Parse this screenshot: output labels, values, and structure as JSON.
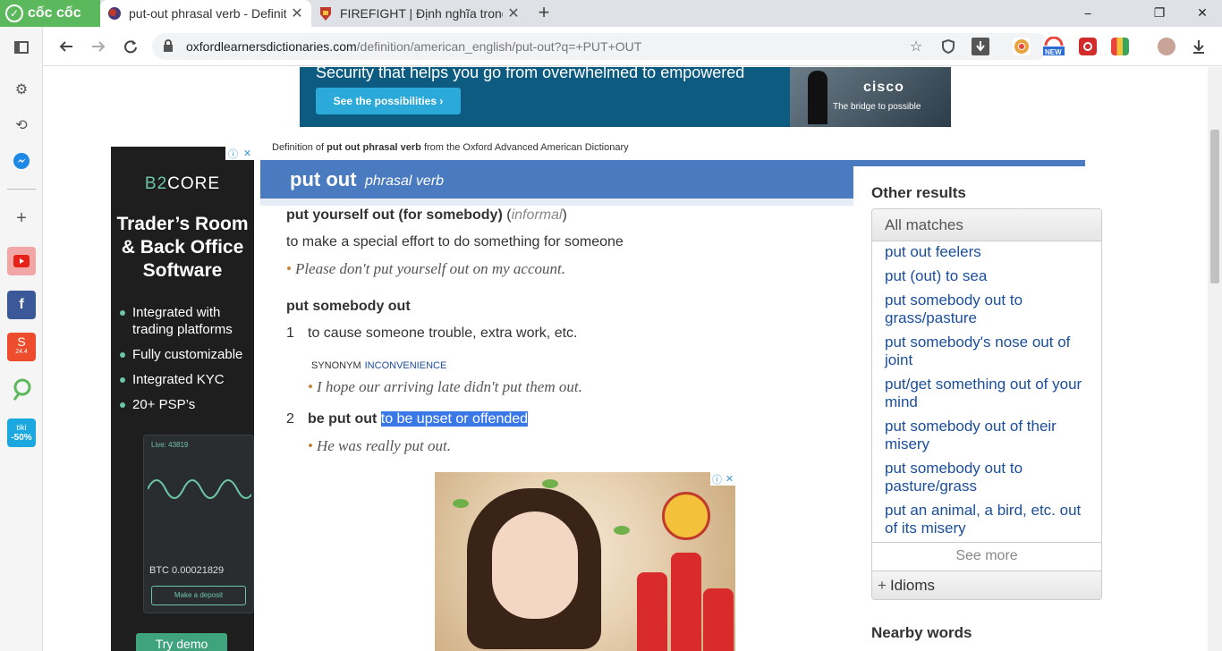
{
  "browser": {
    "brand": "cốc cốc",
    "tabs": [
      {
        "label": "put-out phrasal verb - Definiti",
        "active": true
      },
      {
        "label": "FIREFIGHT | Định nghĩa trong",
        "active": false
      }
    ],
    "url_host": "oxfordlearnersdictionaries.com",
    "url_path": "/definition/american_english/put-out?q=+PUT+OUT",
    "extensions": [
      "chrome-icon",
      "new-badge-icon",
      "red-square-icon",
      "color-grid-icon",
      "avatar"
    ],
    "ext_new_label": "NEW"
  },
  "sidepanel": {
    "shopee_label": "24.4",
    "tiki_label": "tiki",
    "tiki_discount": "-50%"
  },
  "top_ad": {
    "headline": "Security that helps you go from overwhelmed to empowered",
    "cta": "See the possibilities ›",
    "brand": "cisco",
    "tagline": "The bridge to possible"
  },
  "left_ad": {
    "brand_prefix": "B2",
    "brand_suffix": "CORE",
    "heading": "Trader’s Room & Back Office Software",
    "features": [
      "Integrated with trading platforms",
      "Fully customizable",
      "Integrated KYC",
      "20+ PSP’s"
    ],
    "balance": "Live: 43819",
    "btc": "BTC 0.00021829",
    "deposit": "Make a deposit",
    "cta": "Try demo"
  },
  "source": {
    "prefix": "Definition of ",
    "term": "put out phrasal verb",
    "suffix": " from the Oxford Advanced American Dictionary"
  },
  "entry": {
    "headword": "put out",
    "pos": "phrasal verb",
    "idiom1": {
      "phrase": "put yourself out (for somebody)",
      "label": "informal",
      "definition": "to make a special effort to do something for someone",
      "example": "Please don't put yourself out on my account."
    },
    "idiom2": {
      "phrase": "put somebody out",
      "sense1_num": "1",
      "sense1_def": "to cause someone trouble, extra work, etc.",
      "synonym_label": "SYNONYM",
      "synonym": "INCONVENIENCE",
      "sense1_example": "I hope our arriving late didn't put them out.",
      "sense2_num": "2",
      "sense2_phrase": "be put out",
      "sense2_def": "to be upset or offended",
      "sense2_example": "He was really put out."
    }
  },
  "other_results": {
    "title": "Other results",
    "tab": "All matches",
    "items": [
      "put out feelers",
      "put (out) to sea",
      "put somebody out to grass/pasture",
      "put somebody's nose out of joint",
      "put/get something out of your mind",
      "put somebody out of their misery",
      "put somebody out to pasture/grass",
      "put an animal, a bird, etc. out of its misery"
    ],
    "see_more": "See more",
    "idioms": "Idioms",
    "nearby": "Nearby words"
  }
}
